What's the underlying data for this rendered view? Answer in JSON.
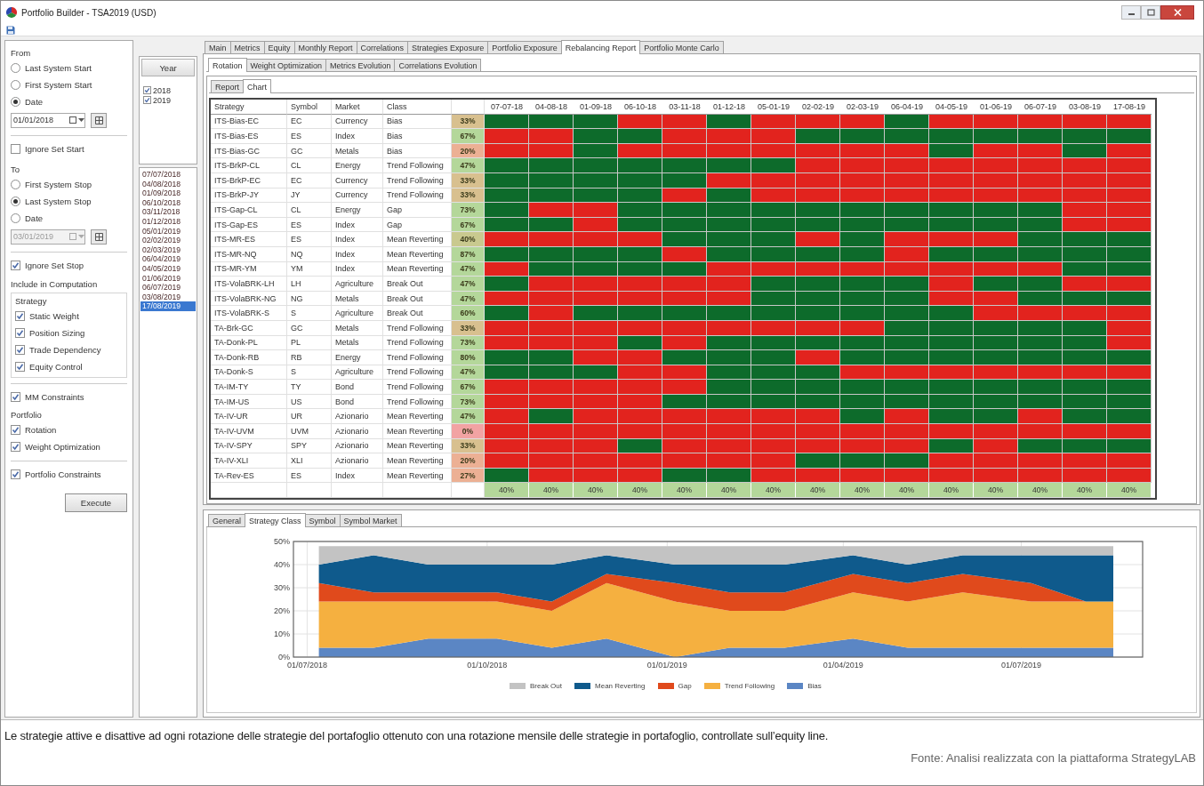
{
  "window": {
    "title": "Portfolio Builder - TSA2019 (USD)"
  },
  "left": {
    "from": {
      "label": "From",
      "options": [
        {
          "label": "Last System Start",
          "selected": false
        },
        {
          "label": "First System Start",
          "selected": false
        },
        {
          "label": "Date",
          "selected": true
        }
      ],
      "date": {
        "value": "01/01/2018",
        "disabled": false
      },
      "ignore": {
        "label": "Ignore Set Start",
        "checked": false
      }
    },
    "to": {
      "label": "To",
      "options": [
        {
          "label": "First System Stop",
          "selected": false
        },
        {
          "label": "Last System Stop",
          "selected": true
        },
        {
          "label": "Date",
          "selected": false
        }
      ],
      "date": {
        "value": "03/01/2019",
        "disabled": true
      },
      "ignore": {
        "label": "Ignore Set Stop",
        "checked": true
      }
    },
    "include": {
      "label": "Include in Computation",
      "strategy": {
        "label": "Strategy",
        "items": [
          {
            "label": "Static Weight",
            "checked": true
          },
          {
            "label": "Position Sizing",
            "checked": true
          },
          {
            "label": "Trade Dependency",
            "checked": true
          },
          {
            "label": "Equity Control",
            "checked": true
          }
        ]
      },
      "mm": {
        "label": "MM Constraints",
        "checked": true
      },
      "portfolio": {
        "label": "Portfolio",
        "items": [
          {
            "label": "Rotation",
            "checked": true
          },
          {
            "label": "Weight Optimization",
            "checked": true
          }
        ]
      },
      "constraints": {
        "label": "Portfolio Constraints",
        "checked": true
      }
    },
    "execute": "Execute"
  },
  "years": {
    "header": "Year",
    "items": [
      {
        "label": "2018",
        "checked": true
      },
      {
        "label": "2019",
        "checked": true
      }
    ]
  },
  "dates": [
    {
      "label": "07/07/2018",
      "selected": false
    },
    {
      "label": "04/08/2018",
      "selected": false
    },
    {
      "label": "01/09/2018",
      "selected": false
    },
    {
      "label": "06/10/2018",
      "selected": false
    },
    {
      "label": "03/11/2018",
      "selected": false
    },
    {
      "label": "01/12/2018",
      "selected": false
    },
    {
      "label": "05/01/2019",
      "selected": false
    },
    {
      "label": "02/02/2019",
      "selected": false
    },
    {
      "label": "02/03/2019",
      "selected": false
    },
    {
      "label": "06/04/2019",
      "selected": false
    },
    {
      "label": "04/05/2019",
      "selected": false
    },
    {
      "label": "01/06/2019",
      "selected": false
    },
    {
      "label": "06/07/2019",
      "selected": false
    },
    {
      "label": "03/08/2019",
      "selected": false
    },
    {
      "label": "17/08/2019",
      "selected": true
    }
  ],
  "tabs": [
    {
      "label": "Main",
      "selected": false
    },
    {
      "label": "Metrics",
      "selected": false
    },
    {
      "label": "Equity",
      "selected": false
    },
    {
      "label": "Monthly Report",
      "selected": false
    },
    {
      "label": "Correlations",
      "selected": false
    },
    {
      "label": "Strategies Exposure",
      "selected": false
    },
    {
      "label": "Portfolio Exposure",
      "selected": false
    },
    {
      "label": "Rebalancing Report",
      "selected": true
    },
    {
      "label": "Portfolio Monte Carlo",
      "selected": false
    }
  ],
  "subtabs": [
    {
      "label": "Rotation",
      "selected": true
    },
    {
      "label": "Weight Optimization",
      "selected": false
    },
    {
      "label": "Metrics Evolution",
      "selected": false
    },
    {
      "label": "Correlations Evolution",
      "selected": false
    }
  ],
  "view_tabs": [
    {
      "label": "Report",
      "selected": false
    },
    {
      "label": "Chart",
      "selected": true
    }
  ],
  "table": {
    "columns": [
      "Strategy",
      "Symbol",
      "Market",
      "Class"
    ],
    "dates": [
      "07-07-18",
      "04-08-18",
      "01-09-18",
      "06-10-18",
      "03-11-18",
      "01-12-18",
      "05-01-19",
      "02-02-19",
      "02-03-19",
      "06-04-19",
      "04-05-19",
      "01-06-19",
      "06-07-19",
      "03-08-19",
      "17-08-19"
    ],
    "rows": [
      {
        "strategy": "ITS-Bias-EC",
        "symbol": "EC",
        "market": "Currency",
        "class": "Bias",
        "percent": "33%",
        "color": "#d8c08f",
        "active": [
          true,
          true,
          true,
          false,
          false,
          true,
          false,
          false,
          false,
          true,
          false,
          false,
          false,
          false,
          false
        ]
      },
      {
        "strategy": "ITS-Bias-ES",
        "symbol": "ES",
        "market": "Index",
        "class": "Bias",
        "percent": "67%",
        "color": "#b4d79a",
        "active": [
          false,
          false,
          true,
          true,
          false,
          false,
          false,
          true,
          true,
          true,
          true,
          true,
          true,
          true,
          true
        ]
      },
      {
        "strategy": "ITS-Bias-GC",
        "symbol": "GC",
        "market": "Metals",
        "class": "Bias",
        "percent": "20%",
        "color": "#ecb094",
        "active": [
          false,
          false,
          true,
          false,
          false,
          false,
          false,
          false,
          false,
          false,
          true,
          false,
          false,
          true,
          false
        ]
      },
      {
        "strategy": "ITS-BrkP-CL",
        "symbol": "CL",
        "market": "Energy",
        "class": "Trend Following",
        "percent": "47%",
        "color": "#b4d79a",
        "active": [
          true,
          true,
          true,
          true,
          true,
          true,
          true,
          false,
          false,
          false,
          false,
          false,
          false,
          false,
          false
        ]
      },
      {
        "strategy": "ITS-BrkP-EC",
        "symbol": "EC",
        "market": "Currency",
        "class": "Trend Following",
        "percent": "33%",
        "color": "#d8c08f",
        "active": [
          true,
          true,
          true,
          true,
          true,
          false,
          false,
          false,
          false,
          false,
          false,
          false,
          false,
          false,
          false
        ]
      },
      {
        "strategy": "ITS-BrkP-JY",
        "symbol": "JY",
        "market": "Currency",
        "class": "Trend Following",
        "percent": "33%",
        "color": "#d8c08f",
        "active": [
          true,
          true,
          true,
          true,
          false,
          true,
          false,
          false,
          false,
          false,
          false,
          false,
          false,
          false,
          false
        ]
      },
      {
        "strategy": "ITS-Gap-CL",
        "symbol": "CL",
        "market": "Energy",
        "class": "Gap",
        "percent": "73%",
        "color": "#b4d79a",
        "active": [
          true,
          false,
          false,
          true,
          true,
          true,
          true,
          true,
          true,
          true,
          true,
          true,
          true,
          false,
          false
        ]
      },
      {
        "strategy": "ITS-Gap-ES",
        "symbol": "ES",
        "market": "Index",
        "class": "Gap",
        "percent": "67%",
        "color": "#b4d79a",
        "active": [
          true,
          true,
          false,
          true,
          true,
          true,
          true,
          true,
          true,
          true,
          true,
          true,
          true,
          false,
          false
        ]
      },
      {
        "strategy": "ITS-MR-ES",
        "symbol": "ES",
        "market": "Index",
        "class": "Mean Reverting",
        "percent": "40%",
        "color": "#c9c98f",
        "active": [
          false,
          false,
          false,
          false,
          true,
          true,
          true,
          false,
          true,
          false,
          false,
          false,
          true,
          true,
          true
        ]
      },
      {
        "strategy": "ITS-MR-NQ",
        "symbol": "NQ",
        "market": "Index",
        "class": "Mean Reverting",
        "percent": "87%",
        "color": "#b4d79a",
        "active": [
          true,
          true,
          true,
          true,
          false,
          true,
          true,
          true,
          true,
          false,
          true,
          true,
          true,
          true,
          true
        ]
      },
      {
        "strategy": "ITS-MR-YM",
        "symbol": "YM",
        "market": "Index",
        "class": "Mean Reverting",
        "percent": "47%",
        "color": "#b4d79a",
        "active": [
          false,
          true,
          true,
          true,
          true,
          false,
          false,
          false,
          false,
          false,
          false,
          false,
          false,
          true,
          true
        ]
      },
      {
        "strategy": "ITS-VolaBRK-LH",
        "symbol": "LH",
        "market": "Agriculture",
        "class": "Break Out",
        "percent": "47%",
        "color": "#b4d79a",
        "active": [
          true,
          false,
          false,
          false,
          false,
          false,
          true,
          true,
          true,
          true,
          false,
          true,
          true,
          false,
          false
        ]
      },
      {
        "strategy": "ITS-VolaBRK-NG",
        "symbol": "NG",
        "market": "Metals",
        "class": "Break Out",
        "percent": "47%",
        "color": "#b4d79a",
        "active": [
          false,
          false,
          false,
          false,
          false,
          false,
          true,
          true,
          true,
          true,
          false,
          false,
          true,
          true,
          true
        ]
      },
      {
        "strategy": "ITS-VolaBRK-S",
        "symbol": "S",
        "market": "Agriculture",
        "class": "Break Out",
        "percent": "60%",
        "color": "#b4d79a",
        "active": [
          true,
          false,
          true,
          true,
          true,
          true,
          true,
          true,
          true,
          true,
          true,
          false,
          false,
          false,
          false
        ]
      },
      {
        "strategy": "TA-Brk-GC",
        "symbol": "GC",
        "market": "Metals",
        "class": "Trend Following",
        "percent": "33%",
        "color": "#d8c08f",
        "active": [
          false,
          false,
          false,
          false,
          false,
          false,
          false,
          false,
          false,
          true,
          true,
          true,
          true,
          true,
          false
        ]
      },
      {
        "strategy": "TA-Donk-PL",
        "symbol": "PL",
        "market": "Metals",
        "class": "Trend Following",
        "percent": "73%",
        "color": "#b4d79a",
        "active": [
          false,
          false,
          false,
          true,
          false,
          true,
          true,
          true,
          true,
          true,
          true,
          true,
          true,
          true,
          false
        ]
      },
      {
        "strategy": "TA-Donk-RB",
        "symbol": "RB",
        "market": "Energy",
        "class": "Trend Following",
        "percent": "80%",
        "color": "#b4d79a",
        "active": [
          true,
          true,
          false,
          false,
          true,
          true,
          true,
          false,
          true,
          true,
          true,
          true,
          true,
          true,
          true
        ]
      },
      {
        "strategy": "TA-Donk-S",
        "symbol": "S",
        "market": "Agriculture",
        "class": "Trend Following",
        "percent": "47%",
        "color": "#b4d79a",
        "active": [
          true,
          true,
          true,
          false,
          false,
          true,
          true,
          true,
          false,
          false,
          false,
          false,
          false,
          false,
          false
        ]
      },
      {
        "strategy": "TA-IM-TY",
        "symbol": "TY",
        "market": "Bond",
        "class": "Trend Following",
        "percent": "67%",
        "color": "#b4d79a",
        "active": [
          false,
          false,
          false,
          false,
          false,
          true,
          true,
          true,
          true,
          true,
          true,
          true,
          true,
          true,
          true
        ]
      },
      {
        "strategy": "TA-IM-US",
        "symbol": "US",
        "market": "Bond",
        "class": "Trend Following",
        "percent": "73%",
        "color": "#b4d79a",
        "active": [
          false,
          false,
          false,
          false,
          true,
          true,
          true,
          true,
          true,
          true,
          true,
          true,
          true,
          true,
          true
        ]
      },
      {
        "strategy": "TA-IV-UR",
        "symbol": "UR",
        "market": "Azionario",
        "class": "Mean Reverting",
        "percent": "47%",
        "color": "#b4d79a",
        "active": [
          false,
          true,
          false,
          false,
          false,
          false,
          false,
          false,
          true,
          false,
          true,
          true,
          false,
          true,
          true
        ]
      },
      {
        "strategy": "TA-IV-UVM",
        "symbol": "UVM",
        "market": "Azionario",
        "class": "Mean Reverting",
        "percent": "0%",
        "color": "#f2a3a3",
        "active": [
          false,
          false,
          false,
          false,
          false,
          false,
          false,
          false,
          false,
          false,
          false,
          false,
          false,
          false,
          false
        ]
      },
      {
        "strategy": "TA-IV-SPY",
        "symbol": "SPY",
        "market": "Azionario",
        "class": "Mean Reverting",
        "percent": "33%",
        "color": "#d8c08f",
        "active": [
          false,
          false,
          false,
          true,
          false,
          false,
          false,
          false,
          false,
          false,
          true,
          false,
          true,
          true,
          true
        ]
      },
      {
        "strategy": "TA-IV-XLI",
        "symbol": "XLI",
        "market": "Azionario",
        "class": "Mean Reverting",
        "percent": "20%",
        "color": "#ecb094",
        "active": [
          false,
          false,
          false,
          false,
          false,
          false,
          false,
          true,
          true,
          true,
          false,
          false,
          false,
          false,
          false
        ]
      },
      {
        "strategy": "TA-Rev-ES",
        "symbol": "ES",
        "market": "Index",
        "class": "Mean Reverting",
        "percent": "27%",
        "color": "#ecb094",
        "active": [
          true,
          false,
          false,
          false,
          true,
          true,
          false,
          false,
          false,
          false,
          false,
          false,
          false,
          false,
          false
        ]
      }
    ],
    "footer": [
      "40%",
      "40%",
      "40%",
      "40%",
      "40%",
      "40%",
      "40%",
      "40%",
      "40%",
      "40%",
      "40%",
      "40%",
      "40%",
      "40%",
      "40%"
    ]
  },
  "chart_tabs": [
    {
      "label": "General",
      "selected": false
    },
    {
      "label": "Strategy Class",
      "selected": true
    },
    {
      "label": "Symbol",
      "selected": false
    },
    {
      "label": "Symbol Market",
      "selected": false
    }
  ],
  "chart": {
    "chart_data": {
      "type": "area",
      "stacked": true,
      "grid": true,
      "x": [
        "2018-07-07",
        "2018-08-04",
        "2018-09-01",
        "2018-10-06",
        "2018-11-03",
        "2018-12-01",
        "2019-01-05",
        "2019-02-02",
        "2019-03-02",
        "2019-04-06",
        "2019-05-04",
        "2019-06-01",
        "2019-07-06",
        "2019-08-03",
        "2019-08-17"
      ],
      "xlim": [
        "2018-06-24",
        "2019-09-01"
      ],
      "xticks": [
        {
          "value": "2018-07-01",
          "label": "01/07/2018"
        },
        {
          "value": "2018-10-01",
          "label": "01/10/2018"
        },
        {
          "value": "2019-01-01",
          "label": "01/01/2019"
        },
        {
          "value": "2019-04-01",
          "label": "01/04/2019"
        },
        {
          "value": "2019-07-01",
          "label": "01/07/2019"
        }
      ],
      "ylim": [
        0,
        50
      ],
      "yticks": [
        {
          "value": 0,
          "label": "0%"
        },
        {
          "value": 10,
          "label": "10%"
        },
        {
          "value": 20,
          "label": "20%"
        },
        {
          "value": 30,
          "label": "30%"
        },
        {
          "value": 40,
          "label": "40%"
        },
        {
          "value": 50,
          "label": "50%"
        }
      ],
      "series": [
        {
          "name": "Break Out",
          "color": "#c3c3c3",
          "values": [
            8,
            4,
            8,
            8,
            8,
            4,
            8,
            8,
            8,
            4,
            8,
            4,
            4,
            4,
            4
          ]
        },
        {
          "name": "Mean Reverting",
          "color": "#0f5a8c",
          "values": [
            8,
            16,
            12,
            12,
            16,
            8,
            8,
            12,
            12,
            8,
            8,
            8,
            12,
            20,
            20
          ]
        },
        {
          "name": "Gap",
          "color": "#e04a1c",
          "values": [
            8,
            4,
            4,
            4,
            4,
            4,
            8,
            8,
            8,
            8,
            8,
            8,
            8,
            0,
            0
          ]
        },
        {
          "name": "Trend Following",
          "color": "#f5b040",
          "values": [
            20,
            20,
            16,
            16,
            16,
            24,
            24,
            16,
            16,
            20,
            20,
            24,
            20,
            20,
            20
          ]
        },
        {
          "name": "Bias",
          "color": "#5b86c4",
          "values": [
            4,
            4,
            8,
            8,
            4,
            8,
            0,
            4,
            4,
            8,
            4,
            4,
            4,
            4,
            4
          ]
        }
      ]
    }
  },
  "caption": "Le strategie attive e disattive ad ogni rotazione delle strategie del portafoglio ottenuto con una rotazione mensile delle strategie in portafoglio, controllate sull’equity line.",
  "source": "Fonte: Analisi realizzata con la piattaforma StrategyLAB"
}
